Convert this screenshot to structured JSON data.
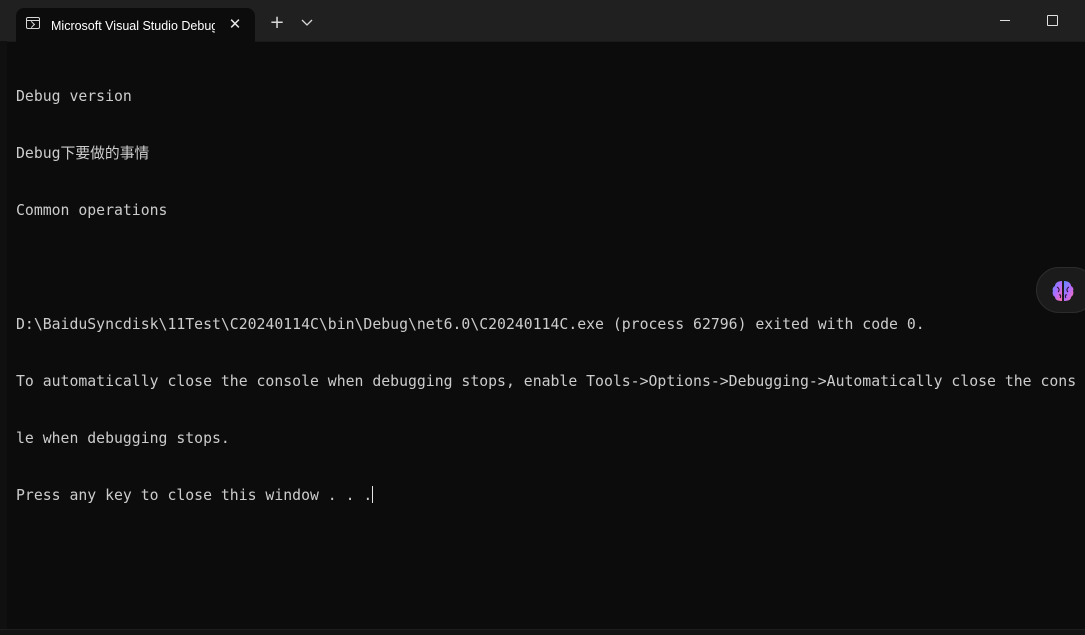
{
  "window": {
    "tab_title": "Microsoft Visual Studio Debug Console",
    "tab_close_glyph": "✕",
    "new_tab_glyph": "+",
    "dropdown_glyph": "⌵",
    "tab_icon": "terminal-icon"
  },
  "console": {
    "lines": [
      "Debug version",
      "Debug下要做的事情",
      "Common operations",
      "",
      "D:\\BaiduSyncdisk\\11Test\\C20240114C\\bin\\Debug\\net6.0\\C20240114C.exe (process 62796) exited with code 0.",
      "To automatically close the console when debugging stops, enable Tools->Options->Debugging->Automatically close the cons",
      "le when debugging stops.",
      "Press any key to close this window . . ."
    ]
  },
  "colors": {
    "background": "#0c0c0c",
    "titlebar": "#202020",
    "text": "#cccccc"
  },
  "side_badge": {
    "icon": "brain-icon"
  }
}
